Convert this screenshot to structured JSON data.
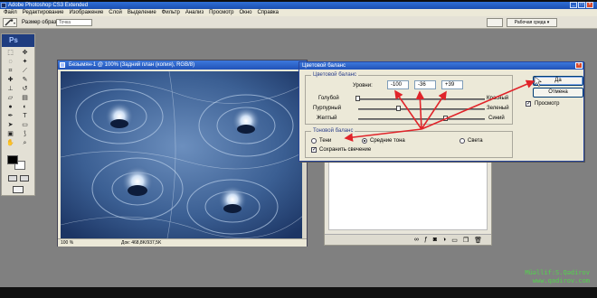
{
  "app": {
    "title": "Adobe Photoshop CS3 Extended",
    "window_buttons": [
      "_",
      "□",
      "×"
    ]
  },
  "menu": [
    "Файл",
    "Редактирование",
    "Изображение",
    "Слой",
    "Выделение",
    "Фильтр",
    "Анализ",
    "Просмотр",
    "Окно",
    "Справка"
  ],
  "options_bar": {
    "sample_label": "Размер образца:",
    "sample_value": "Точка",
    "workspace_button": "Рабочая среда ▾"
  },
  "toolbox": {
    "logo": "Ps"
  },
  "document": {
    "title": "Безымян-1 @ 100% (Задний план (копия), RGB/8)",
    "zoom": "100 %",
    "info": "Док: 468,8K/937,5K"
  },
  "dialog": {
    "title": "Цветовой баланс",
    "color_balance_legend": "Цветовой баланс",
    "levels_label": "Уровни:",
    "levels": [
      "-100",
      "-36",
      "+39"
    ],
    "sliders": [
      {
        "left": "Голубой",
        "right": "Красный",
        "value": -100
      },
      {
        "left": "Пурпурный",
        "right": "Зеленый",
        "value": -36
      },
      {
        "left": "Желтый",
        "right": "Синий",
        "value": 39
      }
    ],
    "tone_legend": "Тоновой баланс",
    "tones": {
      "shadows": "Тени",
      "midtones": "Средние тона",
      "highlights": "Света"
    },
    "selected_tone": "midtones",
    "preserve_luminosity": "Сохранить свечение",
    "ok": "Да",
    "cancel": "Отмена",
    "preview": "Просмотр"
  },
  "watermark": {
    "line1": "Müəllif:S.Qədirov",
    "line2": "www.qadirov.com"
  },
  "colors": {
    "annotation_arrow": "#e0242a",
    "title_blue": "#2a60c8",
    "watermark": "#52d34c"
  }
}
